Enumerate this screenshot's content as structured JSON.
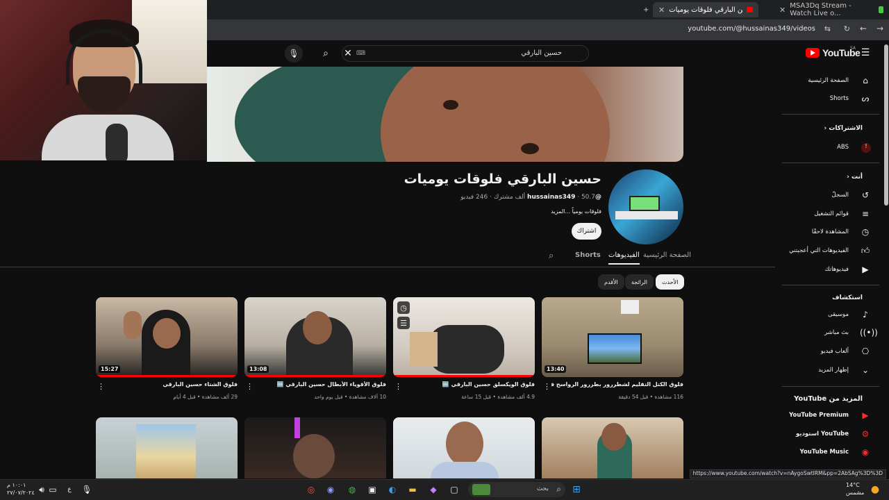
{
  "browser": {
    "tabs": [
      {
        "title": "حسين البارقي فلوقات يوميات - ..."
      },
      {
        "title": "MSA3Dq Stream - Watch Live o..."
      }
    ],
    "url": "youtube.com/@hussainas349/videos",
    "status_url": "https://www.youtube.com/watch?v=nAygoSwtIRM&pp=2AbSAg%3D%3D"
  },
  "masthead": {
    "search_value": "حسين البارقي",
    "logo_text": "YouTube",
    "country": "SA"
  },
  "channel": {
    "name": "حسين البارقي فلوقات يوميات",
    "handle": "@hussainas349",
    "subscribers": "50.7 ألف مشترك",
    "videos_count": "246 فيديو",
    "description": "فلوقات يومياً",
    "more_label": "...المزيد",
    "subscribe_label": "اشتراك"
  },
  "tabs": [
    "الصفحة الرئيسية",
    "الفيديوهات",
    "Shorts"
  ],
  "active_tab": "الفيديوهات",
  "chips": [
    "الأحدث",
    "الرائجة",
    "الأقدم"
  ],
  "videos": [
    {
      "title": "فلوق الشتاء حسين البارقي",
      "meta": "29 ألف مشاهدة • قبل 4 أيام",
      "duration": "15:27",
      "progress": 1.0
    },
    {
      "title": "فلوق الأقوياء الأبطال حسين البارقي 🆒",
      "meta": "10 آلاف مشاهدة • قبل يوم واحد",
      "duration": "13:08",
      "progress": 1.0
    },
    {
      "title": "فلوق الويكسلق حسين البارقي 🆒",
      "meta": "4.9 ألف مشاهدة • قبل 15 ساعة",
      "duration": "",
      "progress": 1.0
    },
    {
      "title": "فلوق الكتل التقليم لشطررور بطررور الرواسح في خطر ✌",
      "meta": "116 مشاهدة • قبل 54 دقيقة",
      "duration": "13:40",
      "progress": 0
    }
  ],
  "sidebar": {
    "main": [
      {
        "label": "الصفحة الرئيسية",
        "icon": "home-icon"
      },
      {
        "label": "Shorts",
        "icon": "shorts-icon"
      }
    ],
    "subscriptions_heading": "الاشتراكات",
    "subscriptions": [
      {
        "label": "ABS"
      }
    ],
    "you_heading": "أنت",
    "you": [
      {
        "label": "السجلّ",
        "icon": "history-icon"
      },
      {
        "label": "قوائم التشغيل",
        "icon": "playlist-icon"
      },
      {
        "label": "المشاهدة لاحقًا",
        "icon": "clock-icon"
      },
      {
        "label": "الفيديوهات التي أعجبتني",
        "icon": "like-icon"
      },
      {
        "label": "فيديوهاتك",
        "icon": "your-videos-icon"
      }
    ],
    "explore_heading": "استكشاف",
    "explore": [
      {
        "label": "موسيقى",
        "icon": "music-icon"
      },
      {
        "label": "بث مباشر",
        "icon": "live-icon"
      },
      {
        "label": "ألعاب فيديو",
        "icon": "gaming-icon"
      },
      {
        "label": "إظهار المزيد",
        "icon": "chevron-down-icon"
      }
    ],
    "more_heading": "المزيد من YouTube",
    "more": [
      {
        "label": "YouTube Premium"
      },
      {
        "label": "YouTube استوديو"
      },
      {
        "label": "YouTube Music"
      }
    ]
  },
  "taskbar": {
    "search_placeholder": "بحث",
    "time": "١٠:٠١ م",
    "date": "٢٧/٠٧/٢٠٢٤",
    "weather_temp": "14°C",
    "weather_desc": "مشمس"
  }
}
